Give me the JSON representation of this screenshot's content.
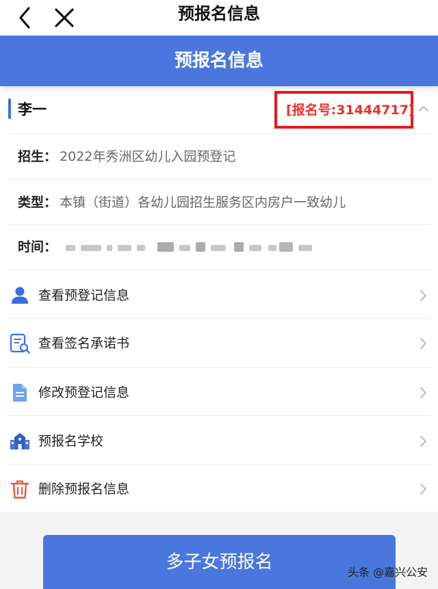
{
  "nav": {
    "title": "预报名信息",
    "back_icon": "chevron-left-icon",
    "close_icon": "close-icon"
  },
  "banner": {
    "title": "预报名信息"
  },
  "applicant": {
    "name": "李一",
    "registration": "[报名号:31444717]",
    "expand_icon": "chevron-up-icon"
  },
  "info": {
    "enroll_label": "招生：",
    "enroll_value": "2022年秀洲区幼儿入园预登记",
    "type_label": "类型：",
    "type_value": "本镇（街道）各幼儿园招生服务区内房户一致幼儿",
    "time_label": "时间："
  },
  "menu": [
    {
      "label": "查看预登记信息",
      "icon": "user-icon"
    },
    {
      "label": "查看签名承诺书",
      "icon": "document-search-icon"
    },
    {
      "label": "修改预登记信息",
      "icon": "file-icon"
    },
    {
      "label": "预报名学校",
      "icon": "school-icon"
    },
    {
      "label": "删除预报名信息",
      "icon": "trash-icon"
    }
  ],
  "actions": {
    "multi_child_label": "多子女预报名"
  },
  "watermark": "头条 @嘉兴公安",
  "colors": {
    "accent": "#4a77de",
    "highlight_red": "#e8161d",
    "user_icon": "#3b6ee0",
    "doc_icon": "#3b6ee0",
    "file_icon": "#6aa6e8",
    "trash_icon": "#e8533d"
  }
}
